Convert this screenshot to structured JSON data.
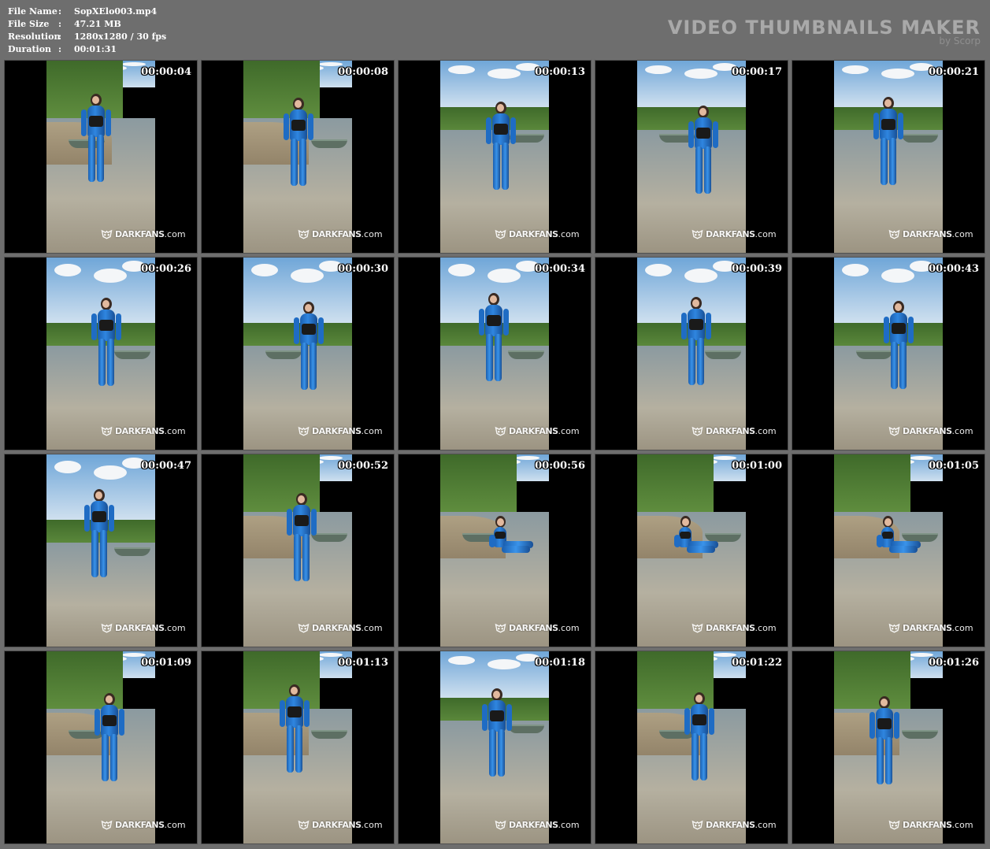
{
  "info": {
    "rows": [
      {
        "label": "File Name",
        "value": "SopXElo003.mp4"
      },
      {
        "label": "File Size",
        "value": "47.21 MB"
      },
      {
        "label": "Resolution",
        "value": "1280x1280 / 30 fps"
      },
      {
        "label": "Duration",
        "value": "00:01:31"
      }
    ],
    "separator": ":"
  },
  "brand": {
    "title": "VIDEO THUMBNAILS MAKER",
    "subtitle": "by Scorp"
  },
  "watermark": {
    "bold": "DARKFANS",
    "rest": ".com",
    "icon": "mask-logo-icon"
  },
  "colors": {
    "background": "#6e6e6e",
    "suit": "#2f86e0",
    "letterbox": "#000000"
  },
  "thumbnails": [
    {
      "time": "00:00:04",
      "scene": "bank"
    },
    {
      "time": "00:00:08",
      "scene": "bank"
    },
    {
      "time": "00:00:13",
      "scene": "river"
    },
    {
      "time": "00:00:17",
      "scene": "river"
    },
    {
      "time": "00:00:21",
      "scene": "river"
    },
    {
      "time": "00:00:26",
      "scene": "sky"
    },
    {
      "time": "00:00:30",
      "scene": "sky"
    },
    {
      "time": "00:00:34",
      "scene": "sky"
    },
    {
      "time": "00:00:39",
      "scene": "sky"
    },
    {
      "time": "00:00:43",
      "scene": "sky"
    },
    {
      "time": "00:00:47",
      "scene": "sky"
    },
    {
      "time": "00:00:52",
      "scene": "bank"
    },
    {
      "time": "00:00:56",
      "scene": "bank"
    },
    {
      "time": "00:01:00",
      "scene": "bank"
    },
    {
      "time": "00:01:05",
      "scene": "bank"
    },
    {
      "time": "00:01:09",
      "scene": "bank"
    },
    {
      "time": "00:01:13",
      "scene": "bank"
    },
    {
      "time": "00:01:18",
      "scene": "river"
    },
    {
      "time": "00:01:22",
      "scene": "bank"
    },
    {
      "time": "00:01:26",
      "scene": "bank"
    }
  ]
}
